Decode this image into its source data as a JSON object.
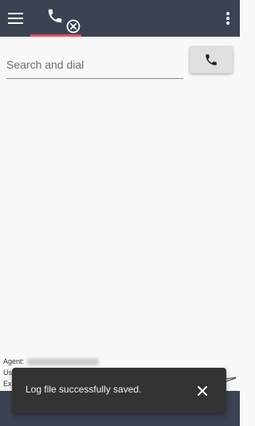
{
  "colors": {
    "topbar": "#3b4353",
    "tab_indicator": "#e0505f",
    "snackbar_bg": "#333333",
    "page_bg": "#f8f8f8"
  },
  "header": {
    "menu_icon": "hamburger-icon",
    "tab_icon": "phone-icon",
    "tab_badge_icon": "close-circle-icon",
    "more_icon": "more-vert-icon"
  },
  "dialer": {
    "search_placeholder": "Search and dial",
    "search_value": "",
    "dial_icon": "phone-icon"
  },
  "info": {
    "agent_label": "Agent:",
    "user_label": "Us",
    "ext_label": "Ex"
  },
  "snackbar": {
    "message": "Log file successfully saved.",
    "close_icon": "close-icon"
  }
}
